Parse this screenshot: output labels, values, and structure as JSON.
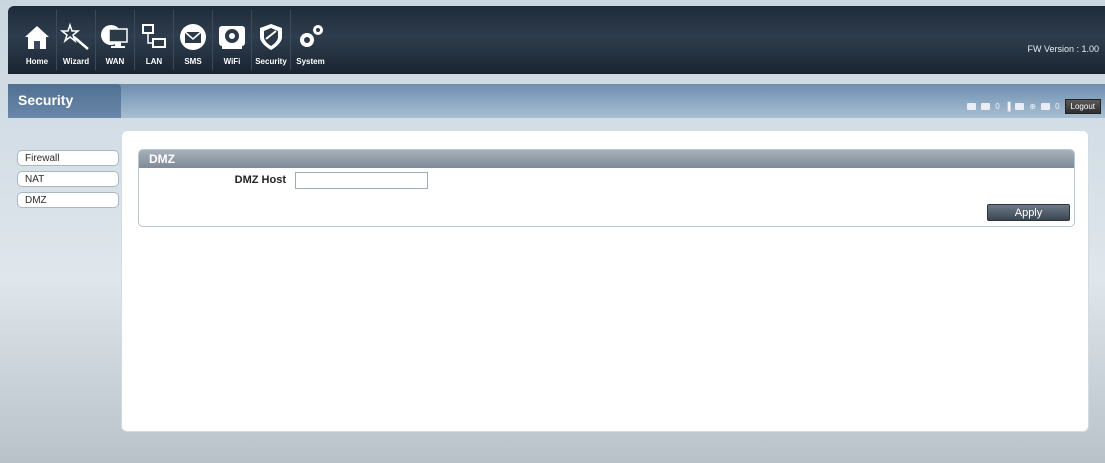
{
  "header": {
    "fw_version": "FW Version : 1.00",
    "nav": [
      {
        "label": "Home",
        "icon": "home-icon"
      },
      {
        "label": "Wizard",
        "icon": "wizard-icon"
      },
      {
        "label": "WAN",
        "icon": "wan-icon"
      },
      {
        "label": "LAN",
        "icon": "lan-icon"
      },
      {
        "label": "SMS",
        "icon": "sms-icon"
      },
      {
        "label": "WiFi",
        "icon": "wifi-icon"
      },
      {
        "label": "Security",
        "icon": "security-icon"
      },
      {
        "label": "System",
        "icon": "system-icon"
      }
    ]
  },
  "section": {
    "title": "Security"
  },
  "status": {
    "sms_count": "0",
    "battery_count": "0",
    "logout_label": "Logout"
  },
  "sidebar": {
    "items": [
      {
        "label": "Firewall"
      },
      {
        "label": "NAT"
      },
      {
        "label": "DMZ"
      }
    ]
  },
  "dmz": {
    "title": "DMZ",
    "host_label": "DMZ Host",
    "host_value": "",
    "apply_label": "Apply"
  }
}
